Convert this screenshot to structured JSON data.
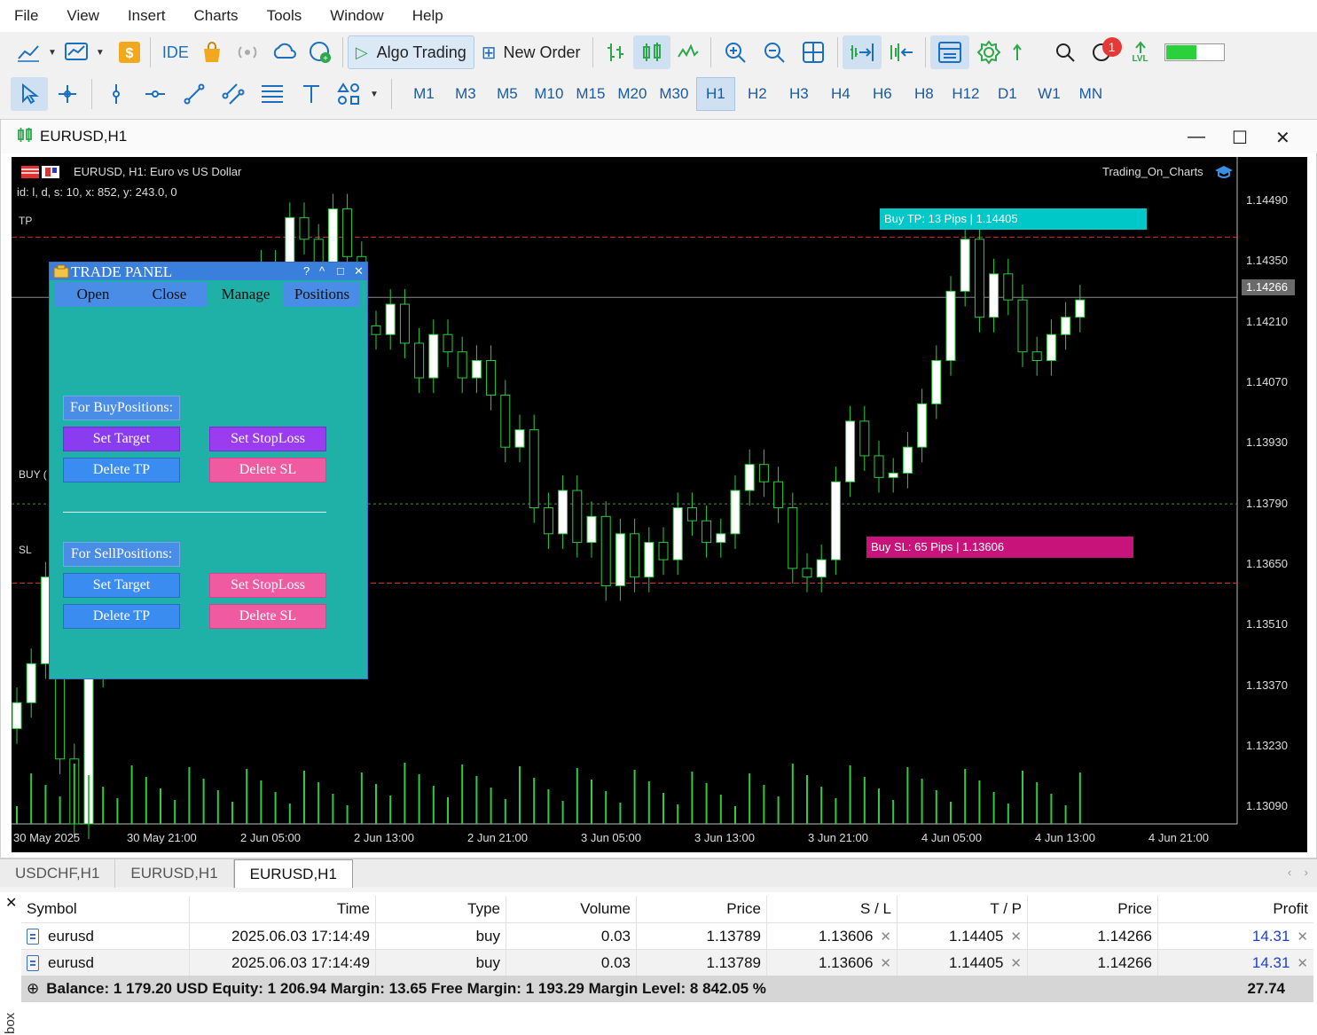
{
  "menu": [
    "File",
    "View",
    "Insert",
    "Charts",
    "Tools",
    "Window",
    "Help"
  ],
  "toolbar": {
    "ide": "IDE",
    "algo_trading": "Algo Trading",
    "new_order": "New Order",
    "notifications": "1",
    "lvl": "LVL"
  },
  "timeframes": [
    "M1",
    "M3",
    "M5",
    "M10",
    "M15",
    "M20",
    "M30",
    "H1",
    "H2",
    "H3",
    "H4",
    "H6",
    "H8",
    "H12",
    "D1",
    "W1",
    "MN"
  ],
  "timeframe_selected": "H1",
  "chart_window": {
    "title": "EURUSD,H1",
    "header_line1": "EURUSD, H1:  Euro vs US Dollar",
    "header_line2": "id: l, d, s:  10, x: 852, y: 243.0,  0",
    "ea_name": "Trading_On_Charts",
    "current_price": "1.14266",
    "level_tp": "TP",
    "level_buy": "BUY (",
    "level_sl": "SL",
    "tp_banner": "Buy TP: 13 Pips | 1.14405",
    "sl_banner": "Buy SL: 65 Pips | 1.13606",
    "accent_green": "#2ecc40",
    "tp_color": "#00c8c8",
    "sl_color": "#c8147a"
  },
  "chart_data": {
    "type": "candlestick",
    "symbol": "EURUSD",
    "timeframe": "H1",
    "y_ticks": [
      "1.14490",
      "1.14350",
      "1.14210",
      "1.14070",
      "1.13930",
      "1.13790",
      "1.13650",
      "1.13510",
      "1.13370",
      "1.13230",
      "1.13090"
    ],
    "x_ticks": [
      "30 May 2025",
      "30 May 21:00",
      "2 Jun 05:00",
      "2 Jun 13:00",
      "2 Jun 21:00",
      "3 Jun 05:00",
      "3 Jun 13:00",
      "3 Jun 21:00",
      "4 Jun 05:00",
      "4 Jun 13:00",
      "4 Jun 21:00"
    ],
    "levels": {
      "tp": 1.14405,
      "buy_entry": 1.13789,
      "sl": 1.13606,
      "current": 1.14266
    },
    "ylim": [
      1.1305,
      1.1459
    ]
  },
  "trade_panel": {
    "title": "TRADE PANEL",
    "tabs": [
      "Open",
      "Close",
      "Manage",
      "Positions"
    ],
    "active_tab": "Manage",
    "buy_header": "For BuyPositions:",
    "sell_header": "For SellPositions:",
    "set_target": "Set Target",
    "set_stoploss": "Set StopLoss",
    "delete_tp": "Delete TP",
    "delete_sl": "Delete SL"
  },
  "chart_tabs": [
    "USDCHF,H1",
    "EURUSD,H1",
    "EURUSD,H1"
  ],
  "active_chart_tab": 2,
  "positions": {
    "columns": [
      "Symbol",
      "Time",
      "Type",
      "Volume",
      "Price",
      "S / L",
      "T / P",
      "Price",
      "Profit"
    ],
    "rows": [
      {
        "symbol": "eurusd",
        "time": "2025.06.03 17:14:49",
        "type": "buy",
        "volume": "0.03",
        "price": "1.13789",
        "sl": "1.13606",
        "tp": "1.14405",
        "cur_price": "1.14266",
        "profit": "14.31"
      },
      {
        "symbol": "eurusd",
        "time": "2025.06.03 17:14:49",
        "type": "buy",
        "volume": "0.03",
        "price": "1.13789",
        "sl": "1.13606",
        "tp": "1.14405",
        "cur_price": "1.14266",
        "profit": "14.31"
      }
    ],
    "balance_line": "Balance: 1 179.20 USD  Equity: 1 206.94  Margin: 13.65  Free Margin: 1 193.29  Margin Level: 8 842.05 %",
    "total_profit": "27.74"
  },
  "toolbox_label": "box"
}
